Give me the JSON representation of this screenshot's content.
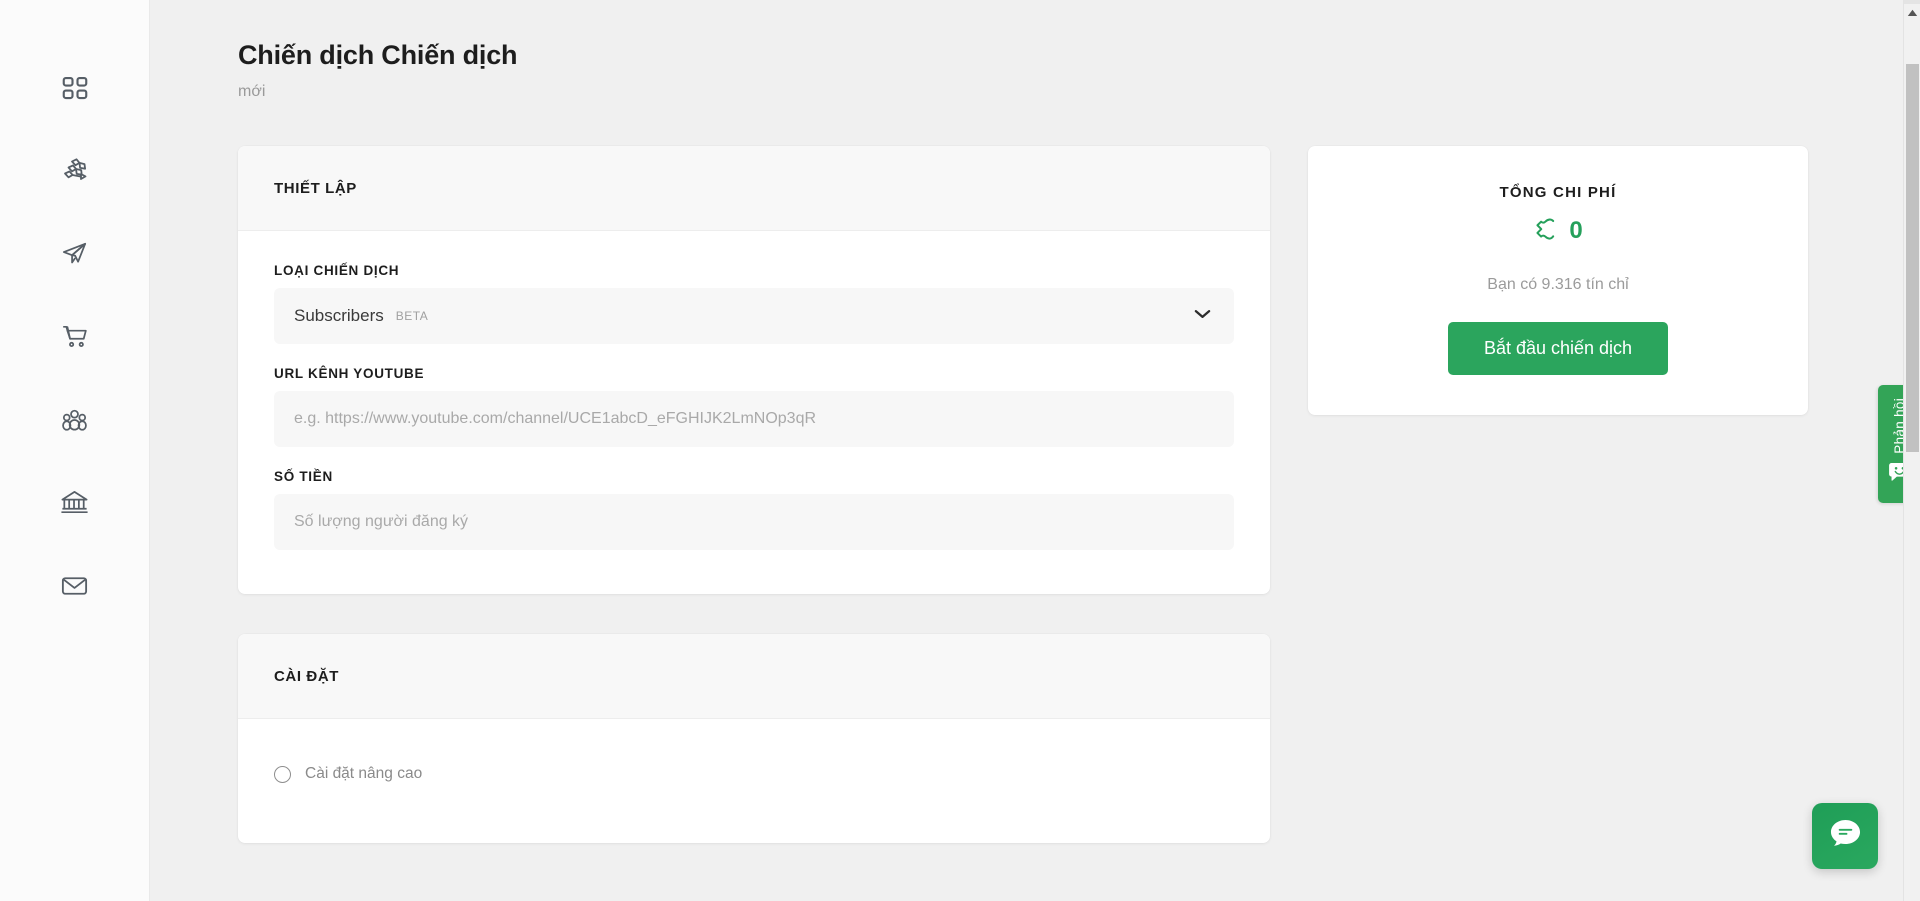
{
  "sidebar": {
    "items": [
      {
        "icon": "dashboard-grid-icon",
        "name": "dashboard"
      },
      {
        "icon": "network-share-icon",
        "name": "network"
      },
      {
        "icon": "send-paper-plane-icon",
        "name": "campaigns"
      },
      {
        "icon": "shopping-cart-icon",
        "name": "store"
      },
      {
        "icon": "people-group-icon",
        "name": "audience"
      },
      {
        "icon": "bank-building-icon",
        "name": "billing"
      },
      {
        "icon": "mail-envelope-icon",
        "name": "messages"
      }
    ]
  },
  "header": {
    "title": "Chiến dịch Chiến dịch",
    "subtitle": "mới"
  },
  "setup_card": {
    "header": "THIẾT LẬP",
    "campaign_type": {
      "label": "LOẠI CHIẾN DỊCH",
      "value": "Subscribers",
      "badge": "BETA",
      "chevron_icon": "chevron-down-icon"
    },
    "youtube_url": {
      "label": "URL KÊNH YOUTUBE",
      "value": "",
      "placeholder": "e.g. https://www.youtube.com/channel/UCE1abcD_eFGHIJK2LmNOp3qR"
    },
    "amount": {
      "label": "SỐ TIỀN",
      "value": "",
      "placeholder": "Số lượng người đăng ký"
    }
  },
  "settings_card": {
    "header": "CÀI ĐẶT",
    "advanced_toggle_label": "Cài đặt nâng cao",
    "advanced_toggle_checked": false
  },
  "summary_card": {
    "title": "TỔNG CHI PHÍ",
    "cost_icon": "credit-coin-icon",
    "cost_value": "0",
    "credits_text": "Bạn có 9.316 tín chỉ",
    "cta_label": "Bắt đầu chiến dịch"
  },
  "feedback_tab": {
    "label": "Phản hồi",
    "icon": "smiley-chat-icon"
  },
  "chat_fab": {
    "icon": "chat-bubble-icon"
  },
  "scrollbar": {
    "up_arrow_icon": "scroll-up-arrow-icon"
  },
  "colors": {
    "accent_green": "#2ba55d",
    "page_bg": "#f0f0f0",
    "card_bg": "#ffffff",
    "input_bg": "#f7f7f7",
    "text_dark": "#1d1d1d",
    "text_muted": "#9a9a9a"
  }
}
